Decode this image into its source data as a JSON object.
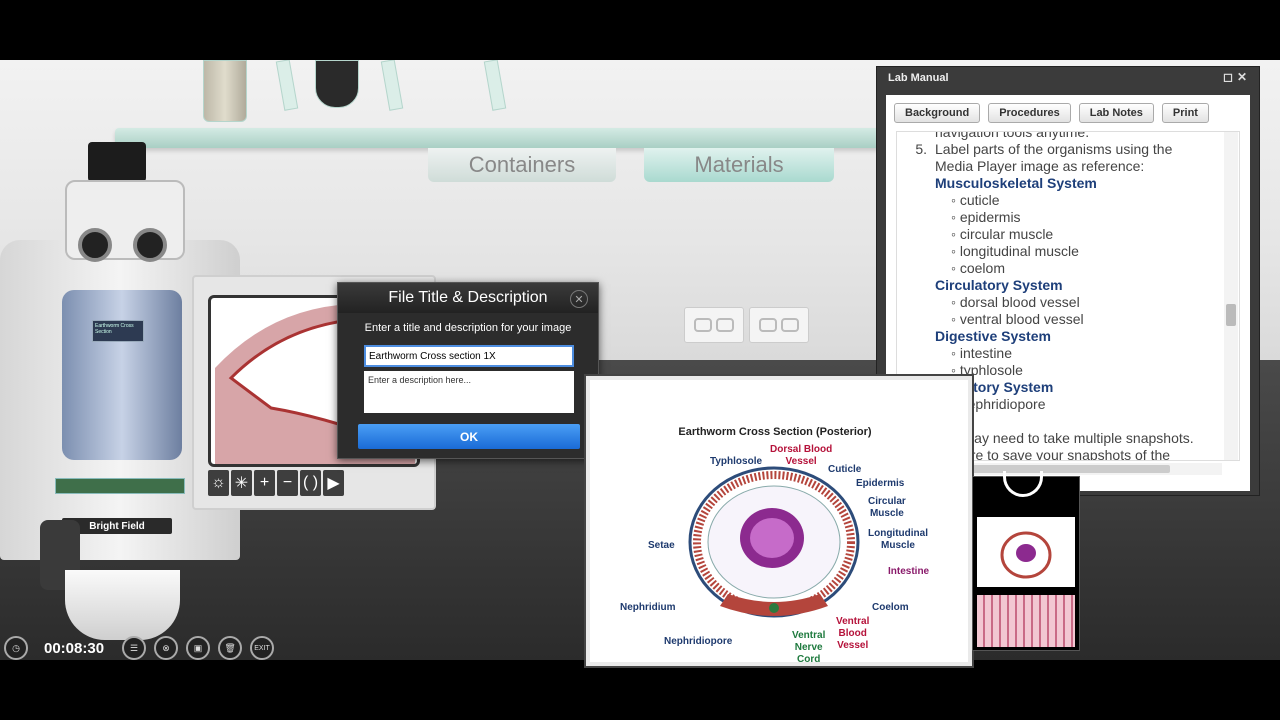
{
  "shelf": {
    "tabs": [
      "Containers",
      "Materials"
    ]
  },
  "microscope": {
    "mode_label": "Bright Field",
    "slide_label": "Earthworm Cross Section"
  },
  "monitor": {
    "controls": [
      "☼",
      "✳",
      "+",
      "−",
      "( )",
      "▶"
    ]
  },
  "dialog": {
    "title": "File Title & Description",
    "close": "✕",
    "prompt": "Enter a title and description for your image",
    "title_value": "Earthworm Cross section 1X",
    "desc_placeholder": "Enter a description here...",
    "ok_label": "OK"
  },
  "lab_manual": {
    "title": "Lab Manual",
    "window_icons": "◻✕",
    "tabs": [
      "Background",
      "Procedures",
      "Lab Notes",
      "Print"
    ],
    "lines": {
      "cut_top": "navigation tools anytime.",
      "step_num": "5.",
      "step_text_1": "Label parts of the organisms using the",
      "step_text_2": "Media Player image as reference:",
      "sys1": "Musculoskeletal System",
      "sys1_items": [
        "cuticle",
        "epidermis",
        "circular muscle",
        "longitudinal muscle",
        "coelom"
      ],
      "sys2": "Circulatory System",
      "sys2_items": [
        "dorsal blood vessel",
        "ventral blood vessel"
      ],
      "sys3": "Digestive System",
      "sys3_items": [
        "intestine",
        "typhlosole"
      ],
      "sys4": "Excretory System",
      "sys4_items": [
        "nephridiopore"
      ],
      "note_1": "You may need to take multiple snapshots.",
      "note_2": "Be sure to save your snapshots of the"
    }
  },
  "media": {
    "title": "Earthworm Cross Section (Posterior)",
    "labels": {
      "dorsal": "Dorsal Blood\nVessel",
      "typhlosole": "Typhlosole",
      "cuticle": "Cuticle",
      "epidermis": "Epidermis",
      "circular": "Circular\nMuscle",
      "longitudinal": "Longitudinal\nMuscle",
      "intestine": "Intestine",
      "setae": "Setae",
      "coelom": "Coelom",
      "nephridium": "Nephridium",
      "ventral_vessel": "Ventral\nBlood\nVessel",
      "ventral_nerve": "Ventral\nNerve\nCord",
      "nephridiopore": "Nephridiopore"
    }
  },
  "timer": {
    "time": "00:08:30",
    "buttons": [
      "☰",
      "⊗",
      "▣",
      "🗑",
      "EXIT"
    ]
  },
  "colors": {
    "accent": "#1a6bd6",
    "system_heading": "#1e3f7a",
    "label_red": "#b5123a",
    "label_purple": "#8a1b6b"
  }
}
